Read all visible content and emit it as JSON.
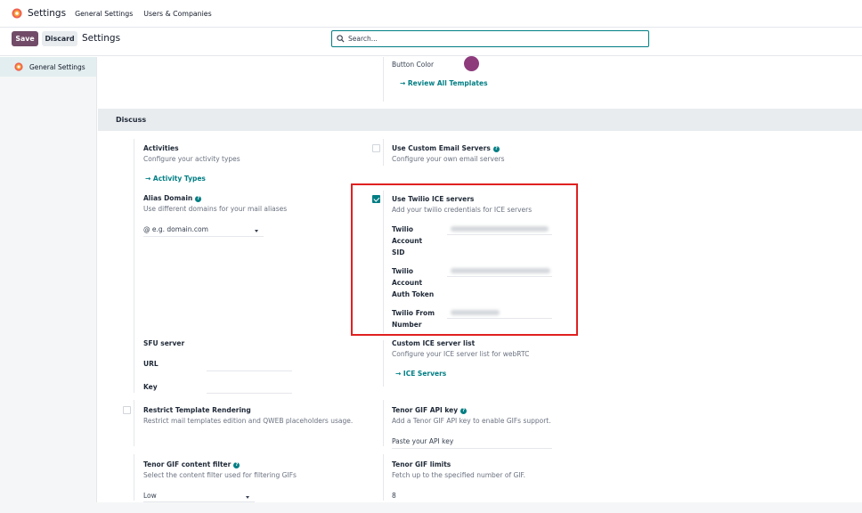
{
  "navbar": {
    "app_title": "Settings",
    "menu_general": "General Settings",
    "menu_users": "Users & Companies"
  },
  "control_panel": {
    "save_label": "Save",
    "discard_label": "Discard",
    "breadcrumb": "Settings",
    "search_placeholder": "Search..."
  },
  "sidebar": {
    "items": [
      {
        "label": "General Settings",
        "icon": "settings-app-icon"
      }
    ]
  },
  "top_remainder": {
    "button_color_label": "Button Color",
    "button_color_value": "#8e3b7c",
    "review_link": "Review All Templates"
  },
  "discuss": {
    "section_title": "Discuss",
    "activities": {
      "title": "Activities",
      "description": "Configure your activity types",
      "link": "Activity Types"
    },
    "alias_domain": {
      "title": "Alias Domain",
      "description": "Use different domains for your mail aliases",
      "placeholder": "@ e.g. domain.com"
    },
    "custom_email": {
      "title": "Use Custom Email Servers",
      "description": "Configure your own email servers",
      "checked": false
    },
    "twilio": {
      "title": "Use Twilio ICE servers",
      "description": "Add your twilio credentials for ICE servers",
      "checked": true,
      "sid_label_1": "Twilio",
      "sid_label_2": "Account",
      "sid_label_3": "SID",
      "token_label_1": "Twilio",
      "token_label_2": "Account",
      "token_label_3": "Auth Token",
      "from_label_1": "Twilio From",
      "from_label_2": "Number"
    },
    "sfu": {
      "title": "SFU server",
      "url_label": "URL",
      "key_label": "Key"
    },
    "ice_list": {
      "title": "Custom ICE server list",
      "description": "Configure your ICE server list for webRTC",
      "link": "ICE Servers"
    },
    "restrict_template": {
      "title": "Restrict Template Rendering",
      "description": "Restrict mail templates edition and QWEB placeholders usage.",
      "checked": false
    },
    "tenor_key": {
      "title": "Tenor GIF API key",
      "description": "Add a Tenor GIF API key to enable GIFs support.",
      "placeholder": "Paste your API key"
    },
    "tenor_filter": {
      "title": "Tenor GIF content filter",
      "description": "Select the content filter used for filtering GIFs",
      "value": "Low"
    },
    "tenor_limits": {
      "title": "Tenor GIF limits",
      "description": "Fetch up to the specified number of GIF.",
      "value": "8"
    }
  },
  "colors": {
    "brand": "#714b67",
    "accent": "#017e84",
    "highlight": "#e02020"
  }
}
